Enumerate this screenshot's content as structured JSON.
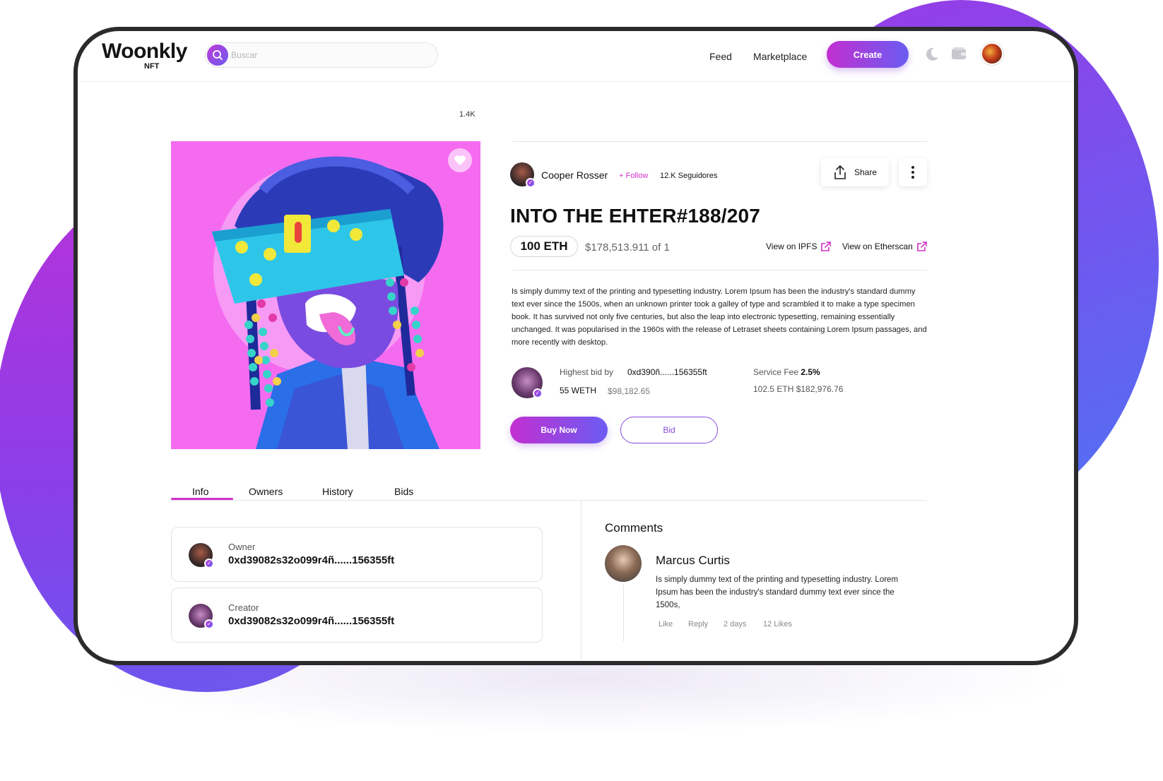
{
  "brand": {
    "logo": "Woonkly",
    "logo_sub": "NFT"
  },
  "search": {
    "placeholder": "Buscar"
  },
  "nav": {
    "feed": "Feed",
    "marketplace": "Marketplace",
    "create": "Create"
  },
  "artwork": {
    "likes": "1.4K"
  },
  "creator": {
    "name": "Cooper Rosser",
    "follow": "+ Follow",
    "followers": "12.K Seguidores"
  },
  "actions": {
    "share": "Share"
  },
  "nft": {
    "title": "INTO THE EHTER#188/207",
    "price": "100 ETH",
    "price_usd": "$178,513.911 of 1",
    "view_ipfs": "View on IPFS",
    "view_etherscan": "View on Etherscan",
    "description": "Is simply dummy text of the printing and typesetting industry. Lorem Ipsum has been the industry's standard dummy text ever since the 1500s, when an unknown printer took a galley of type and scrambled it to make a type specimen book. It has survived not only five centuries, but also the leap into electronic typesetting, remaining essentially unchanged. It was popularised in the 1960s with the release of Letraset sheets containing Lorem Ipsum passages, and more recently with desktop."
  },
  "bid": {
    "label": "Highest bid by",
    "address": "0xd390ñ......156355ft",
    "amount": "55 WETH",
    "amount_usd": "$98,182.65",
    "fee_label": "Service Fee",
    "fee_value": "2.5%",
    "total": "102.5 ETH $182,976.76"
  },
  "buttons": {
    "buy": "Buy Now",
    "bid": "Bid"
  },
  "tabs": [
    {
      "label": "Info",
      "active": true
    },
    {
      "label": "Owners",
      "active": false
    },
    {
      "label": "History",
      "active": false
    },
    {
      "label": "Bids",
      "active": false
    }
  ],
  "info_cards": [
    {
      "role": "Owner",
      "address": "0xd39082s32o099r4ñ......156355ft"
    },
    {
      "role": "Creator",
      "address": "0xd39082s32o099r4ñ......156355ft"
    }
  ],
  "comments": {
    "title": "Comments",
    "items": [
      {
        "author": "Marcus Curtis",
        "text": "Is simply dummy text of the printing and typesetting industry. Lorem Ipsum has been the industry's standard dummy text ever since the 1500s,",
        "like": "Like",
        "reply": "Reply",
        "time": "2 days",
        "likes": "12 Likes"
      }
    ]
  },
  "colors": {
    "accent_pink": "#d12fc9",
    "accent_violet": "#6b5cf2",
    "artwork_bg": "#f56bf0"
  }
}
